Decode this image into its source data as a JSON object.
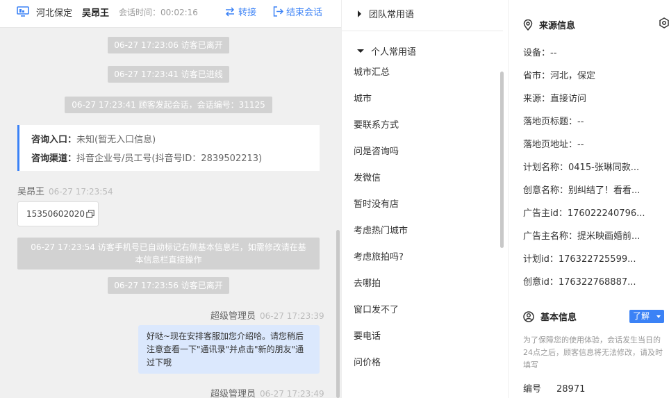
{
  "header": {
    "location": "河北保定",
    "visitor_name": "吴昂王",
    "session_time_label": "会话时间：",
    "session_time": "00:02:16",
    "transfer_label": "转接",
    "end_label": "结束会话"
  },
  "chat": {
    "sys_1": "06-27 17:23:06 访客已离开",
    "sys_2": "06-27 17:23:41 访客已进线",
    "sys_3": "06-27 17:23:41 顾客发起会话，会话编号：31125",
    "info_entry_key": "咨询入口：",
    "info_entry_val": "未知(暂无入口信息)",
    "info_channel_key": "咨询渠道：",
    "info_channel_val": "抖音企业号/员工号(抖音号ID：2839502213)",
    "visitor_name": "吴昂王",
    "visitor_time": "06-27 17:23:54",
    "phone": "15350602020",
    "sys_4_line1": "06-27 17:23:54 访客手机号已自动标记右侧基本信息栏，如需修改请在基",
    "sys_4_line2": "本信息栏直接操作",
    "sys_5": "06-27 17:23:56 访客已离开",
    "agent_name": "超级管理员",
    "agent_time_1": "06-27 17:23:39",
    "agent_msg": "好哒~现在安排客服加您介绍哈。请您稍后注意查看一下\"通讯录\"并点击\"新的朋友\"通过下哦",
    "agent_time_2": "06-27 17:23:49"
  },
  "phrases": {
    "team_group": "团队常用语",
    "personal_group": "个人常用语",
    "items": [
      "城市汇总",
      "城市",
      "要联系方式",
      "问是咨询吗",
      "发微信",
      "暂时没有店",
      "考虑热门城市",
      "考虑旅拍吗?",
      "去哪拍",
      "窗口发不了",
      "要电话",
      "问价格"
    ]
  },
  "info": {
    "source_title": "来源信息",
    "device": "设备：--",
    "province": "省市：河北，保定",
    "source": "来源：直接访问",
    "landing_title": "落地页标题：--",
    "landing_url": "落地页地址：--",
    "plan_name": "计划名称：0415-张琳同款...",
    "creative_name": "创意名称：别纠结了！看看...",
    "advertiser_id": "广告主id：176022240796...",
    "advertiser_name": "广告主名称：提米映画婚前...",
    "plan_id": "计划id：176322725599...",
    "creative_id": "创意id：176322768887...",
    "basic_title": "基本信息",
    "learn_label": "了解",
    "notice": "为了保障您的使用体验，会话发生当日的24点之后，顾客信息将无法修改，请及时填写",
    "number_label": "编号",
    "number_value": "28971"
  },
  "colors": {
    "accent": "#3b82f6",
    "agent_bubble": "#dbe8fd",
    "system_msg": "#d2d2d2"
  }
}
